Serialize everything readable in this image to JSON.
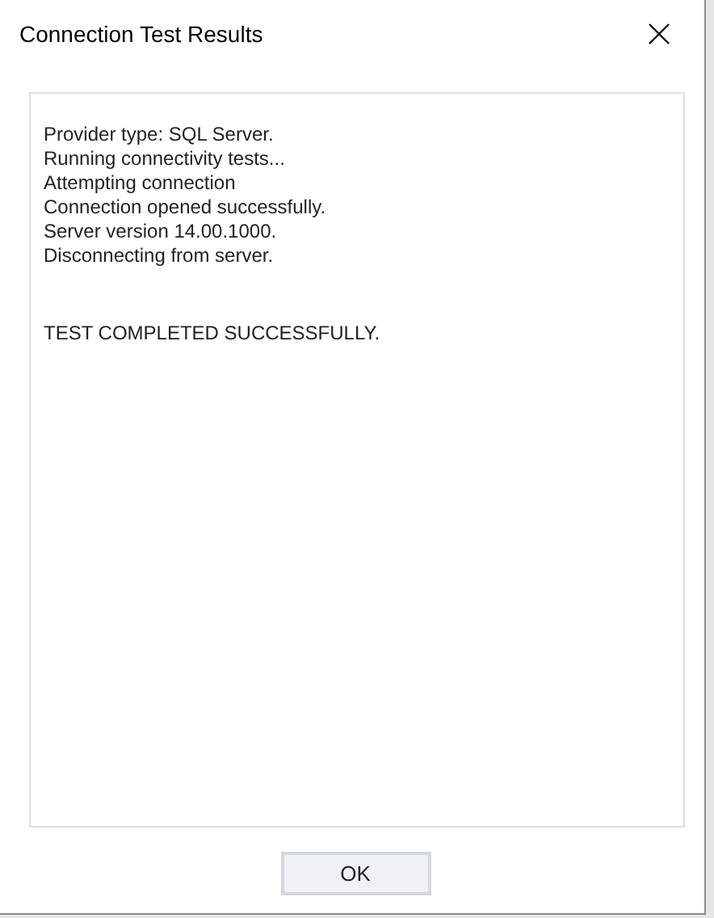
{
  "window": {
    "title": "Connection Test Results"
  },
  "log": {
    "lines": [
      "Provider type: SQL Server.",
      "Running connectivity tests...",
      "Attempting connection",
      "Connection opened successfully.",
      "Server version 14.00.1000.",
      "Disconnecting from server."
    ],
    "result": "TEST COMPLETED SUCCESSFULLY."
  },
  "buttons": [
    "OK"
  ]
}
